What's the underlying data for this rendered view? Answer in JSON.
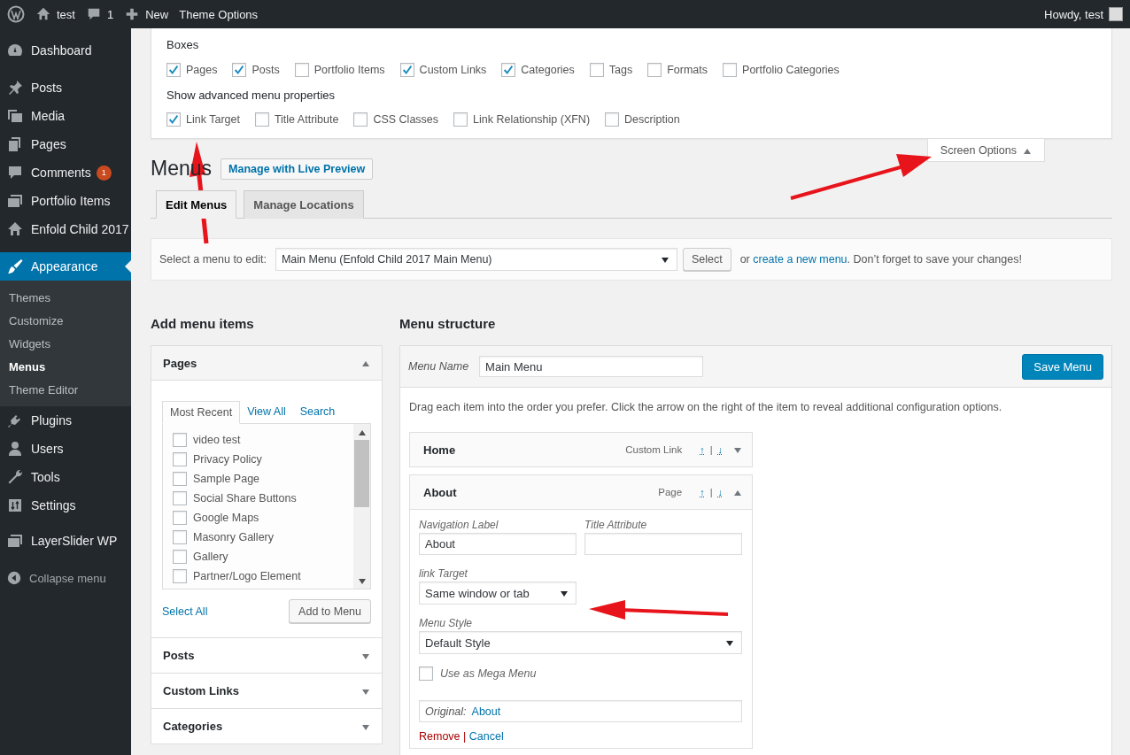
{
  "admin_bar": {
    "site": "test",
    "comments": "1",
    "new": "New",
    "theme_options": "Theme Options",
    "greeting": "Howdy, test"
  },
  "sidebar": {
    "groups": [
      [
        {
          "label": "Dashboard",
          "selected": false
        }
      ],
      [
        {
          "label": "Posts",
          "selected": false
        },
        {
          "label": "Media",
          "selected": false
        },
        {
          "label": "Pages",
          "selected": false
        },
        {
          "label": "Comments",
          "selected": false,
          "badge": "1"
        },
        {
          "label": "Portfolio Items",
          "selected": false
        },
        {
          "label": "Enfold Child 2017",
          "selected": false
        }
      ],
      [
        {
          "label": "Appearance",
          "selected": true,
          "children": [
            {
              "label": "Themes",
              "selected": false
            },
            {
              "label": "Customize",
              "selected": false
            },
            {
              "label": "Widgets",
              "selected": false
            },
            {
              "label": "Menus",
              "selected": true
            },
            {
              "label": "Theme Editor",
              "selected": false
            }
          ]
        },
        {
          "label": "Plugins",
          "selected": false
        },
        {
          "label": "Users",
          "selected": false
        },
        {
          "label": "Tools",
          "selected": false
        },
        {
          "label": "Settings",
          "selected": false
        }
      ],
      [
        {
          "label": "LayerSlider WP",
          "selected": false
        }
      ]
    ],
    "collapse": "Collapse menu"
  },
  "screen_options": {
    "boxes_heading": "Boxes",
    "boxes": [
      {
        "label": "Pages",
        "checked": true
      },
      {
        "label": "Posts",
        "checked": true
      },
      {
        "label": "Portfolio Items",
        "checked": false
      },
      {
        "label": "Custom Links",
        "checked": true
      },
      {
        "label": "Categories",
        "checked": true
      },
      {
        "label": "Tags",
        "checked": false
      },
      {
        "label": "Formats",
        "checked": false
      },
      {
        "label": "Portfolio Categories",
        "checked": false
      }
    ],
    "advanced_heading": "Show advanced menu properties",
    "advanced": [
      {
        "label": "Link Target",
        "checked": true
      },
      {
        "label": "Title Attribute",
        "checked": false
      },
      {
        "label": "CSS Classes",
        "checked": false
      },
      {
        "label": "Link Relationship (XFN)",
        "checked": false
      },
      {
        "label": "Description",
        "checked": false
      }
    ],
    "toggle": "Screen Options",
    "expanded": true
  },
  "title": "Menus",
  "live_preview": "Manage with Live Preview",
  "tabs": [
    {
      "label": "Edit Menus",
      "selected": true
    },
    {
      "label": "Manage Locations",
      "selected": false
    }
  ],
  "select_bar": {
    "label": "Select a menu to edit:",
    "value": "Main Menu (Enfold Child 2017 Main Menu)",
    "button": "Select",
    "note_before": "or",
    "note_link": "create a new menu",
    "note_after": ". Don’t forget to save your changes!"
  },
  "add_items": {
    "heading": "Add menu items",
    "sections": [
      {
        "title": "Pages",
        "expanded": true,
        "tabs": [
          {
            "label": "Most Recent",
            "selected": true
          },
          {
            "label": "View All",
            "selected": false
          },
          {
            "label": "Search",
            "selected": false
          }
        ],
        "items": [
          {
            "label": "video test",
            "checked": false
          },
          {
            "label": "Privacy Policy",
            "checked": false
          },
          {
            "label": "Sample Page",
            "checked": false
          },
          {
            "label": "Social Share Buttons",
            "checked": false
          },
          {
            "label": "Google Maps",
            "checked": false
          },
          {
            "label": "Masonry Gallery",
            "checked": false
          },
          {
            "label": "Gallery",
            "checked": false
          },
          {
            "label": "Partner/Logo Element",
            "checked": false
          }
        ],
        "select_all": "Select All",
        "add_button": "Add to Menu"
      },
      {
        "title": "Posts",
        "expanded": false
      },
      {
        "title": "Custom Links",
        "expanded": false
      },
      {
        "title": "Categories",
        "expanded": false
      }
    ]
  },
  "structure": {
    "heading": "Menu structure",
    "name_label": "Menu Name",
    "name_value": "Main Menu",
    "save": "Save Menu",
    "instructions": "Drag each item into the order you prefer. Click the arrow on the right of the item to reveal additional configuration options.",
    "items": [
      {
        "title": "Home",
        "type": "Custom Link",
        "move_up": "↑",
        "separator": "|",
        "move_down": "↓",
        "expanded": false
      },
      {
        "title": "About",
        "type": "Page",
        "move_up": "↑",
        "separator": "|",
        "move_down": "↓",
        "expanded": true,
        "settings": {
          "nav_label_label": "Navigation Label",
          "nav_label_value": "About",
          "title_attr_label": "Title Attribute",
          "link_target_label": "link Target",
          "link_target_value": "Same window or tab",
          "menu_style_label": "Menu Style",
          "menu_style_value": "Default Style",
          "mega_label": "Use as Mega Menu",
          "mega_checked": false,
          "original_label": "Original:",
          "original_link": "About",
          "remove": "Remove",
          "separator": "|",
          "cancel": "Cancel"
        }
      }
    ]
  }
}
